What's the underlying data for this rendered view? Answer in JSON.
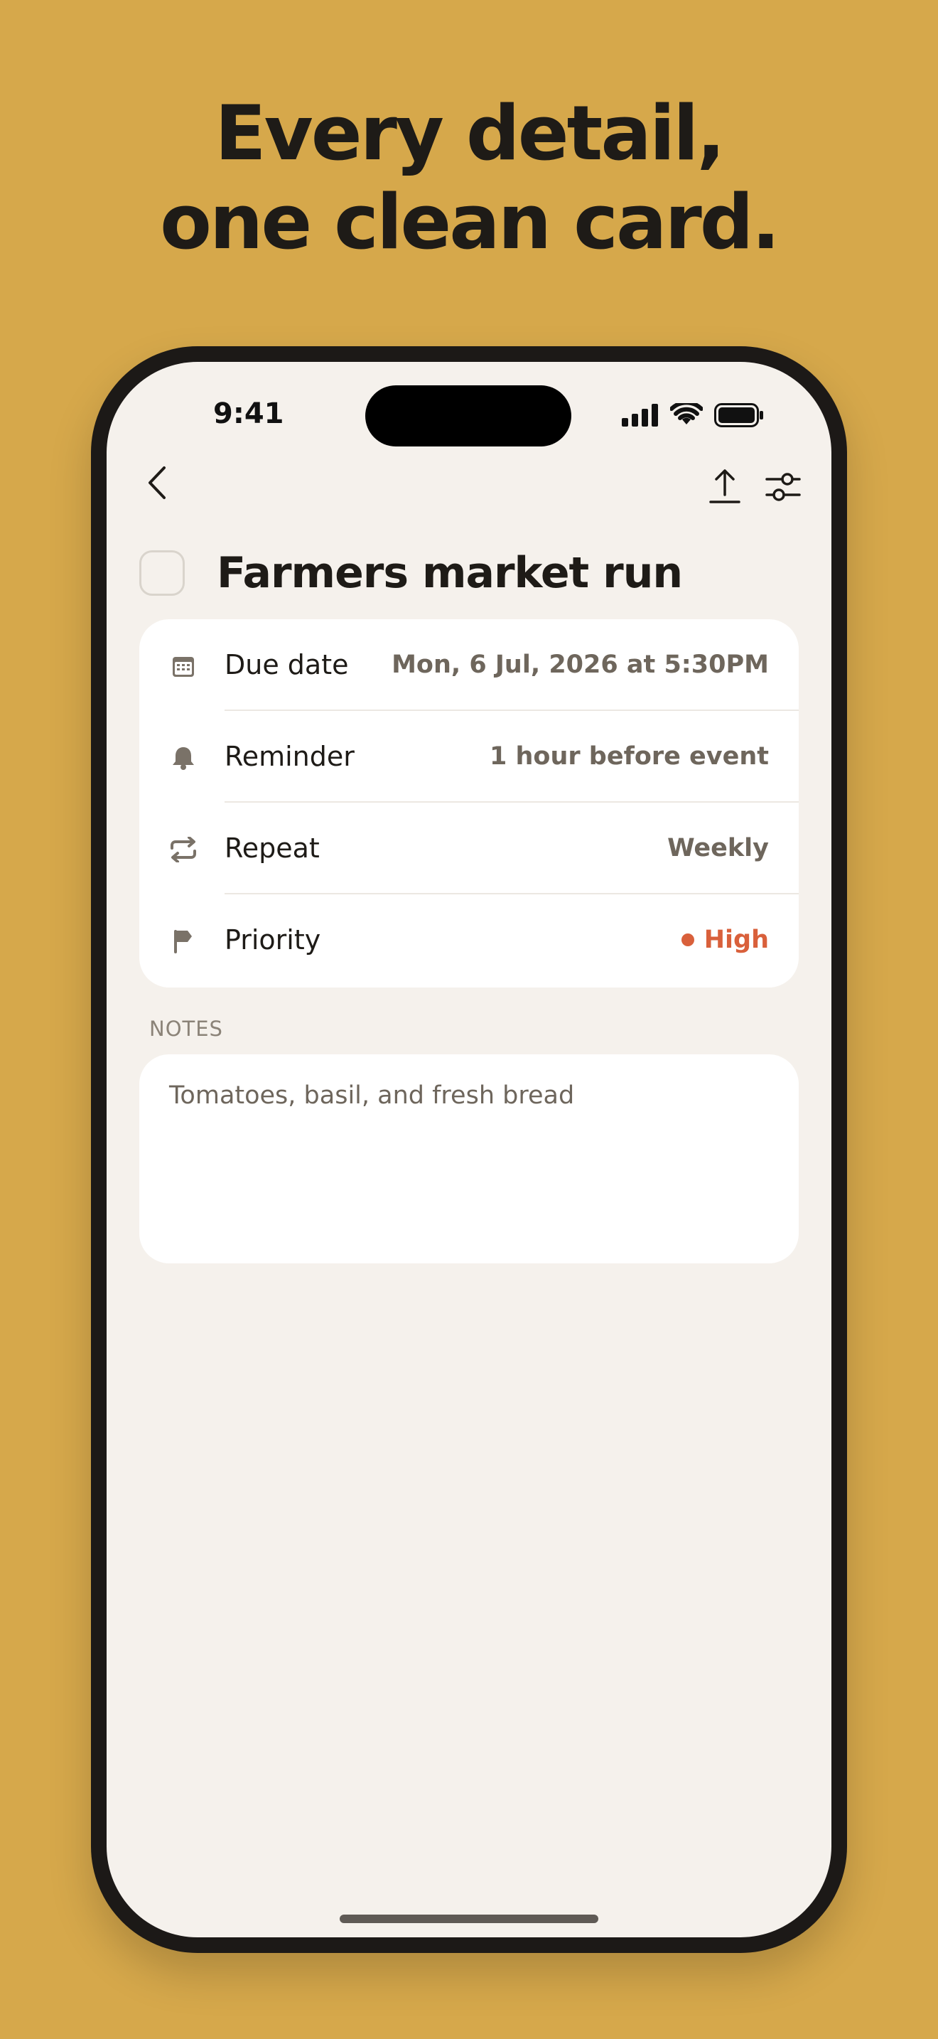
{
  "headline": {
    "line1": "Every detail,",
    "line2": "one clean card."
  },
  "status_bar": {
    "time": "9:41"
  },
  "task": {
    "title": "Farmers market run",
    "completed": false
  },
  "details": [
    {
      "id": "due_date",
      "icon": "calendar-icon",
      "label": "Due date",
      "value": "Mon, 6 Jul, 2026 at 5:30PM"
    },
    {
      "id": "reminder",
      "icon": "bell-icon",
      "label": "Reminder",
      "value": "1 hour before event"
    },
    {
      "id": "repeat",
      "icon": "repeat-icon",
      "label": "Repeat",
      "value": "Weekly"
    },
    {
      "id": "priority",
      "icon": "flag-icon",
      "label": "Priority",
      "value": "High",
      "value_color": "#D9603B"
    }
  ],
  "notes": {
    "label": "NOTES",
    "text": "Tomatoes, basil, and fresh bread"
  },
  "colors": {
    "background": "#D6A84B",
    "screen": "#F5F1EC",
    "card": "#FFFFFF",
    "accent_high": "#D9603B",
    "text": "#1E1B17"
  }
}
